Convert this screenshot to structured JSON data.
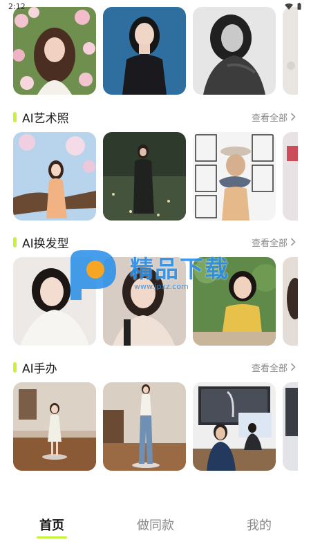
{
  "status_bar": {
    "time": "2:12",
    "wifi_icon": "wifi-icon",
    "battery_icon": "battery-icon"
  },
  "sections": [
    {
      "title": "AI艺术照",
      "see_all": "查看全部"
    },
    {
      "title": "AI换发型",
      "see_all": "查看全部"
    },
    {
      "title": "AI手办",
      "see_all": "查看全部"
    }
  ],
  "tabs": [
    {
      "label": "首页",
      "active": true
    },
    {
      "label": "做同款",
      "active": false
    },
    {
      "label": "我的",
      "active": false
    }
  ],
  "accent_color": "#c8f23a",
  "watermark": {
    "logo": "P",
    "text": "精品下载",
    "url": "www.jpxz.com"
  }
}
